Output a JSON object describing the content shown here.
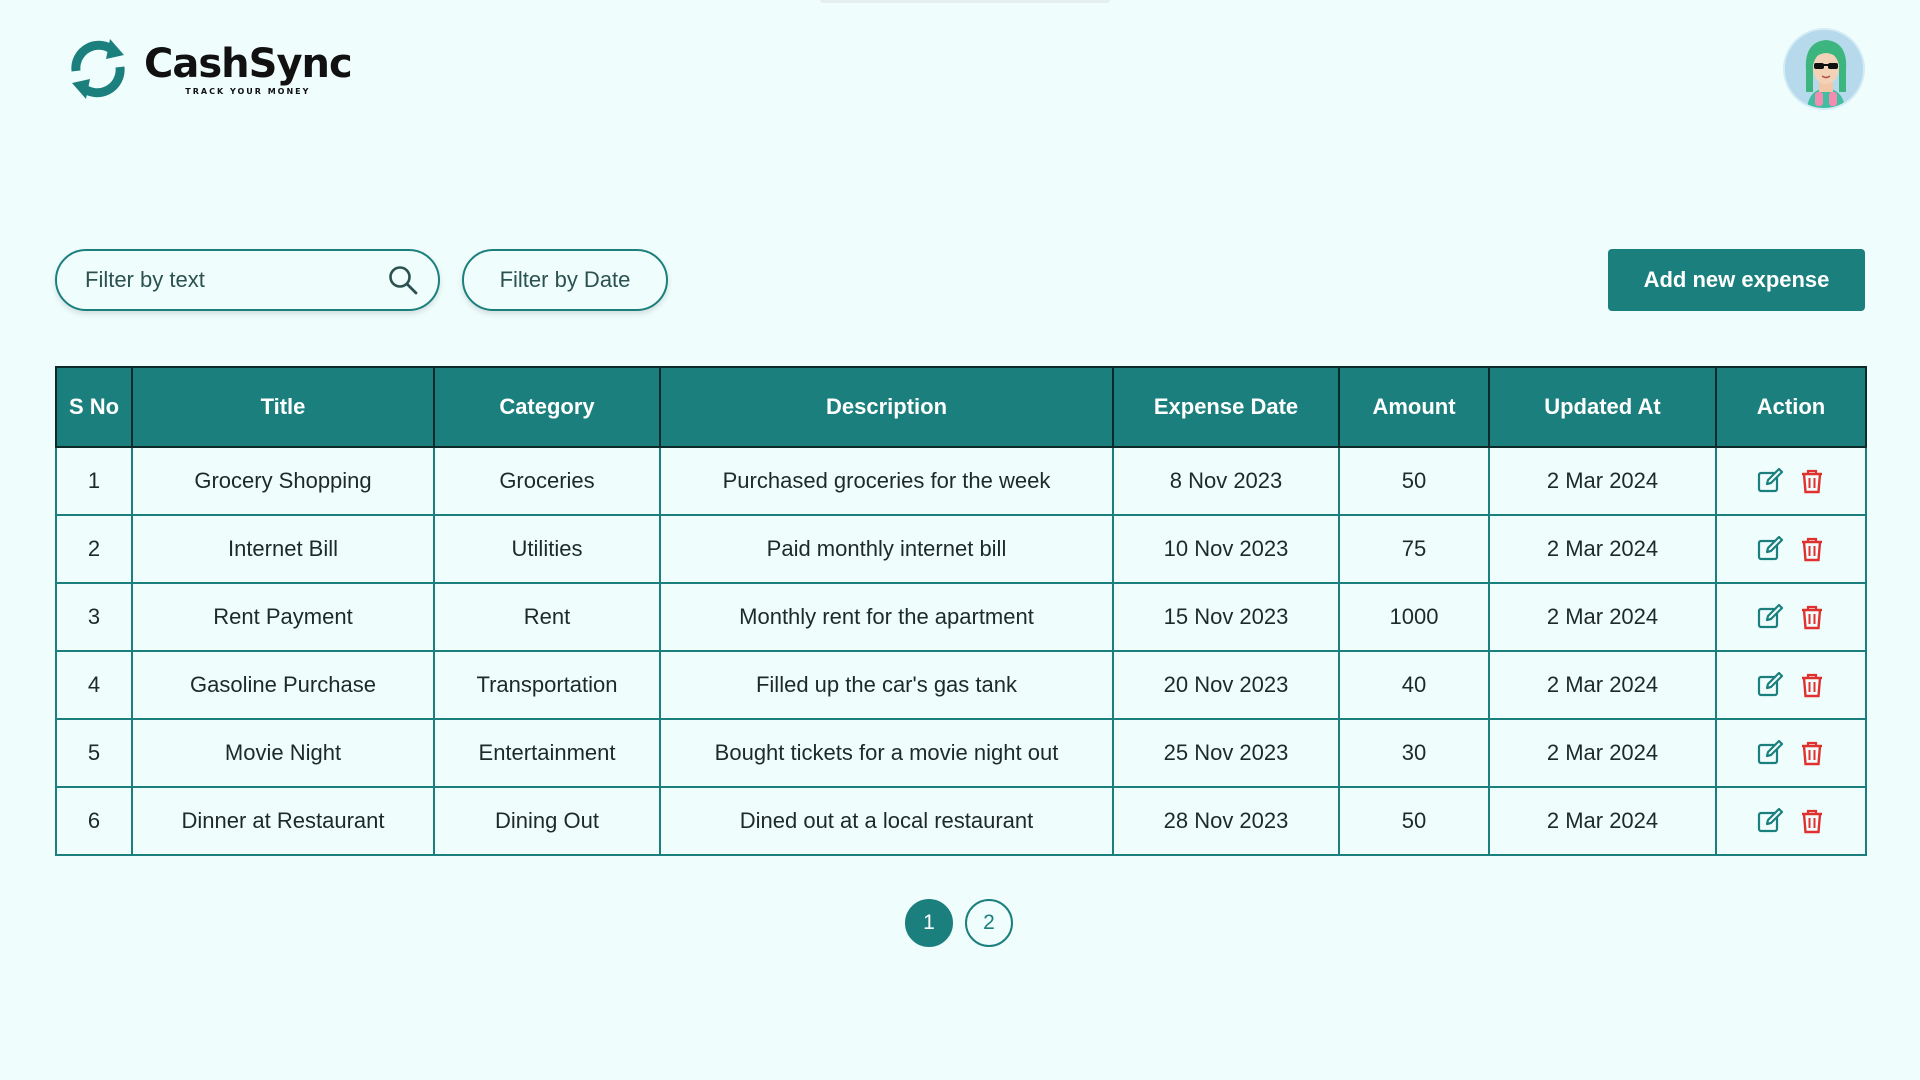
{
  "app": {
    "name": "CashSync",
    "tagline": "TRACK YOUR MONEY"
  },
  "colors": {
    "accent": "#1a7f7d",
    "background": "#f0fdfd",
    "delete": "#e0312f"
  },
  "toolbar": {
    "filter_text_placeholder": "Filter by text",
    "filter_date_label": "Filter by Date",
    "add_label": "Add new expense"
  },
  "table": {
    "headers": [
      "S No",
      "Title",
      "Category",
      "Description",
      "Expense Date",
      "Amount",
      "Updated At",
      "Action"
    ],
    "rows": [
      {
        "sno": "1",
        "title": "Grocery Shopping",
        "category": "Groceries",
        "description": "Purchased groceries for the week",
        "expense_date": "8 Nov 2023",
        "amount": "50",
        "updated_at": "2 Mar 2024"
      },
      {
        "sno": "2",
        "title": "Internet Bill",
        "category": "Utilities",
        "description": "Paid monthly internet bill",
        "expense_date": "10 Nov 2023",
        "amount": "75",
        "updated_at": "2 Mar 2024"
      },
      {
        "sno": "3",
        "title": "Rent Payment",
        "category": "Rent",
        "description": "Monthly rent for the apartment",
        "expense_date": "15 Nov 2023",
        "amount": "1000",
        "updated_at": "2 Mar 2024"
      },
      {
        "sno": "4",
        "title": "Gasoline Purchase",
        "category": "Transportation",
        "description": "Filled up the car's gas tank",
        "expense_date": "20 Nov 2023",
        "amount": "40",
        "updated_at": "2 Mar 2024"
      },
      {
        "sno": "5",
        "title": "Movie Night",
        "category": "Entertainment",
        "description": "Bought tickets for a movie night out",
        "expense_date": "25 Nov 2023",
        "amount": "30",
        "updated_at": "2 Mar 2024"
      },
      {
        "sno": "6",
        "title": "Dinner at Restaurant",
        "category": "Dining Out",
        "description": "Dined out at a local restaurant",
        "expense_date": "28 Nov 2023",
        "amount": "50",
        "updated_at": "2 Mar 2024"
      }
    ],
    "action_icons": [
      "edit-icon",
      "delete-icon"
    ]
  },
  "pagination": {
    "pages": [
      "1",
      "2"
    ],
    "current": "1"
  }
}
